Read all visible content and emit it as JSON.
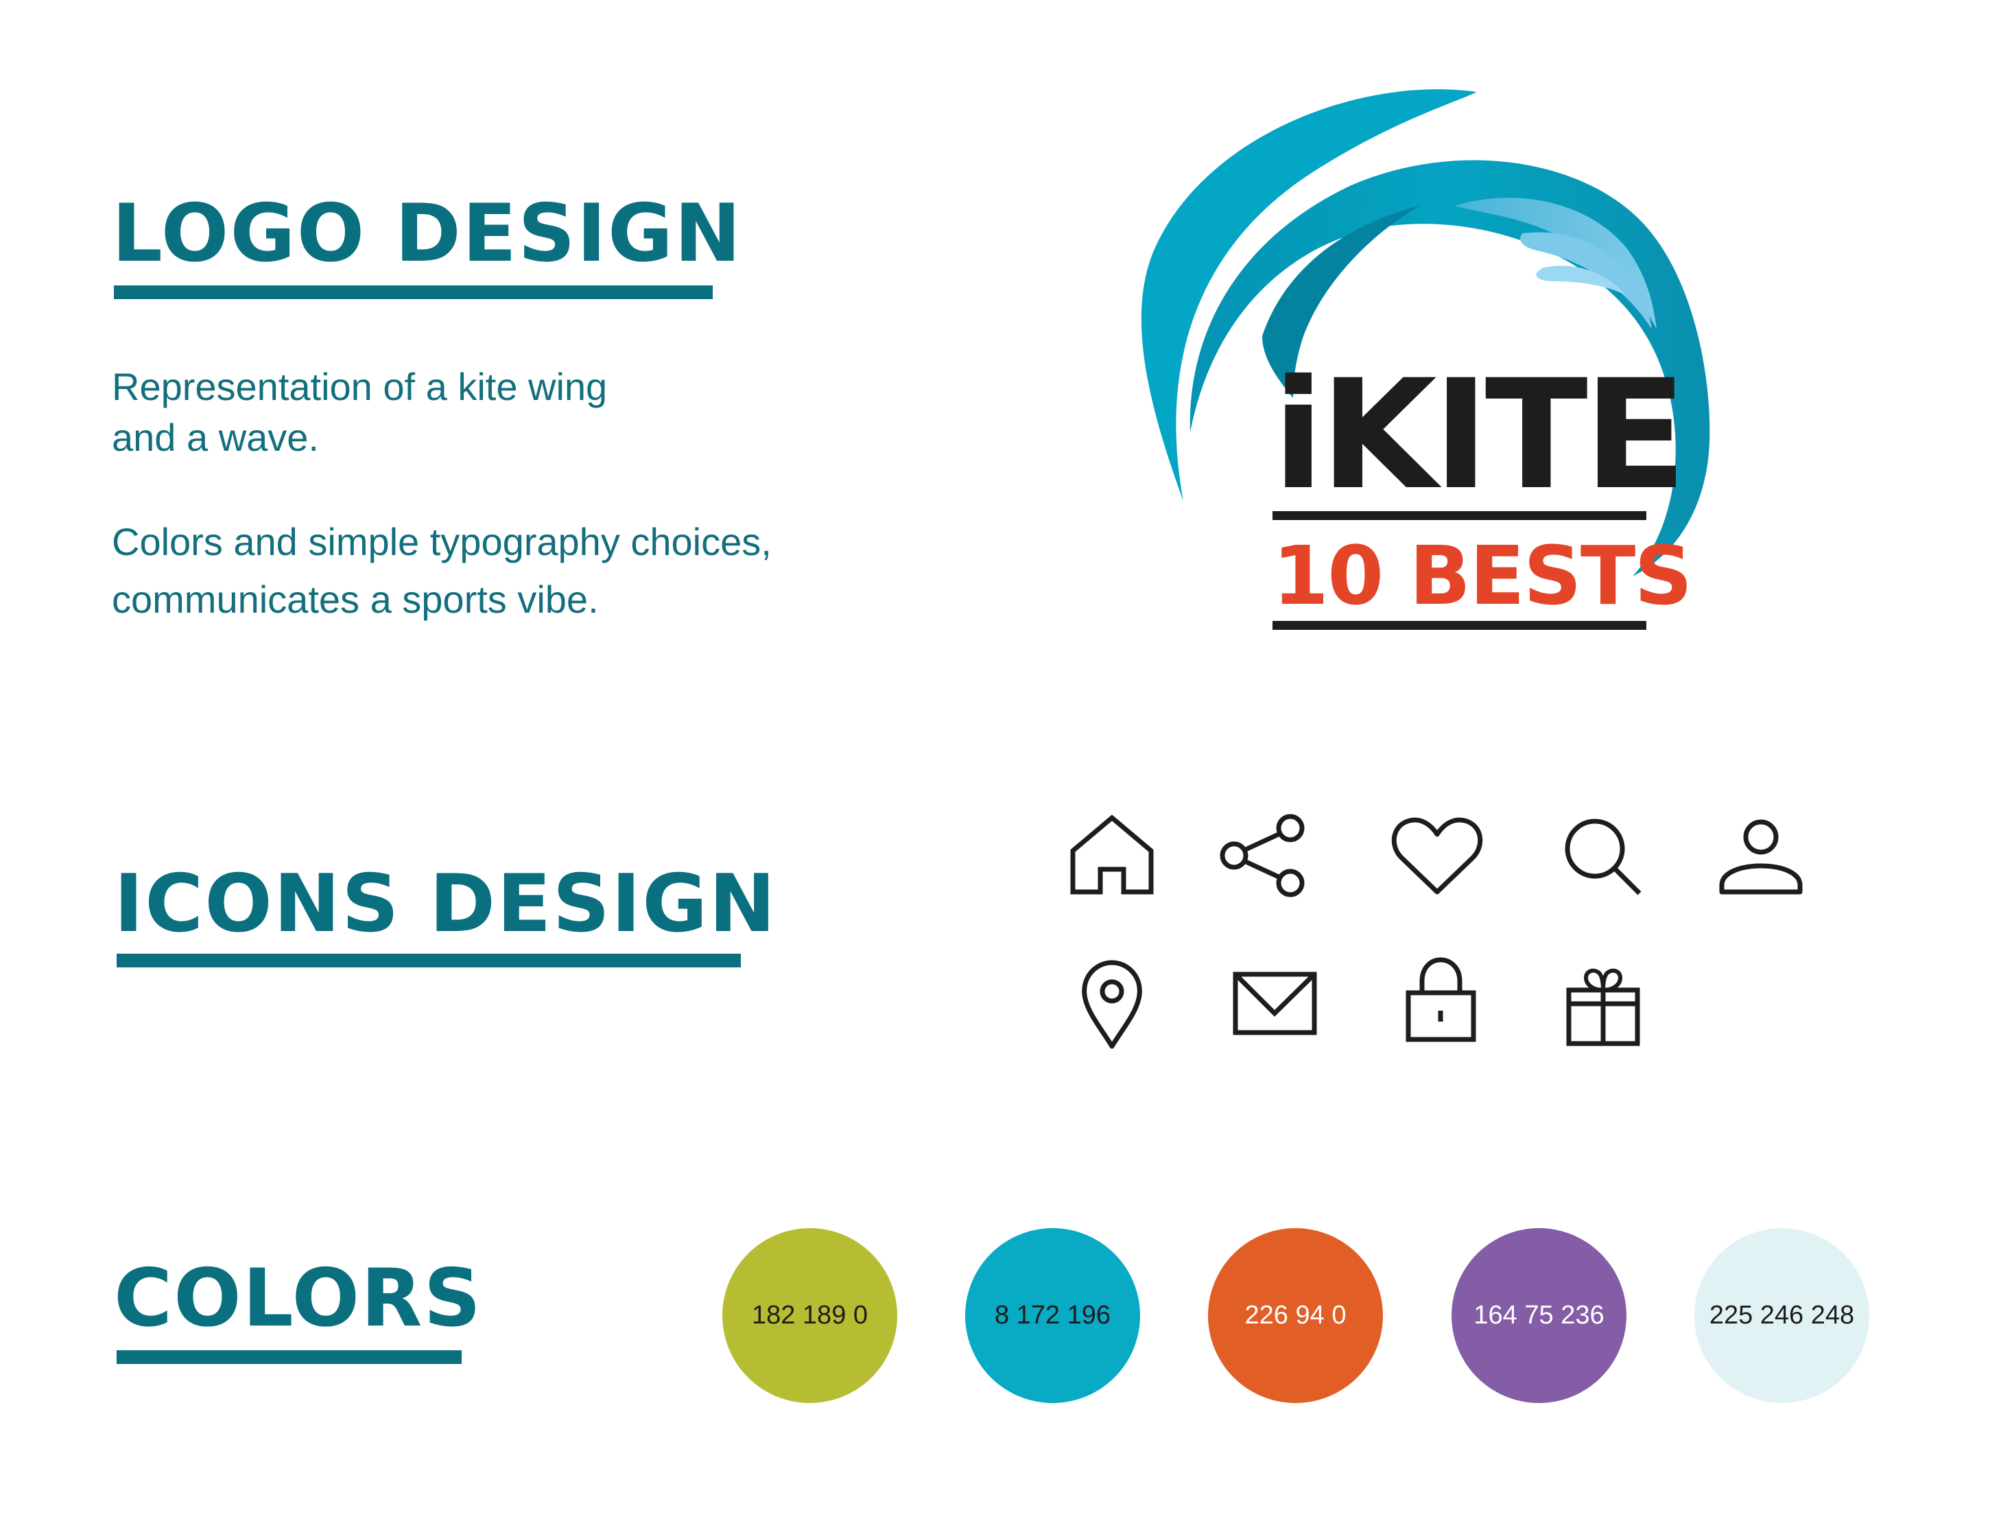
{
  "logo_section": {
    "heading": "LOGO DESIGN",
    "description_lines": [
      "Representation of a kite wing",
      "and a wave."
    ],
    "description2_lines": [
      "Colors and simple typography choices,",
      "communicates a sports vibe."
    ]
  },
  "logo": {
    "brand": "iKITE",
    "tagline": "10 BESTS",
    "colors": {
      "wave_dark": "#05a3c2",
      "wave_light": "#79c9e8",
      "text_dark": "#1d1d1b",
      "text_accent": "#e44427"
    }
  },
  "icons_section": {
    "heading": "ICONS DESIGN",
    "icons": [
      "home-icon",
      "share-icon",
      "heart-icon",
      "search-icon",
      "user-icon",
      "location-pin-icon",
      "envelope-icon",
      "lock-icon",
      "gift-icon"
    ]
  },
  "colors_section": {
    "heading": "COLORS",
    "swatches": [
      {
        "label": "182 189 0",
        "color": "#b7bd32",
        "text_color": "#1d1d1b"
      },
      {
        "label": "8 172 196",
        "color": "#08aac4",
        "text_color": "#1d1d1b"
      },
      {
        "label": "226 94 0",
        "color": "#e15e26",
        "text_color": "#ffffff"
      },
      {
        "label": "164 75 236",
        "color": "#855ca6",
        "text_color": "#ffffff"
      },
      {
        "label": "225 246 248",
        "color": "#e1f2f5",
        "text_color": "#1d1d1b"
      }
    ]
  },
  "theme": {
    "heading_color": "#0a6f7f",
    "icon_stroke": "#1d1d1b"
  }
}
